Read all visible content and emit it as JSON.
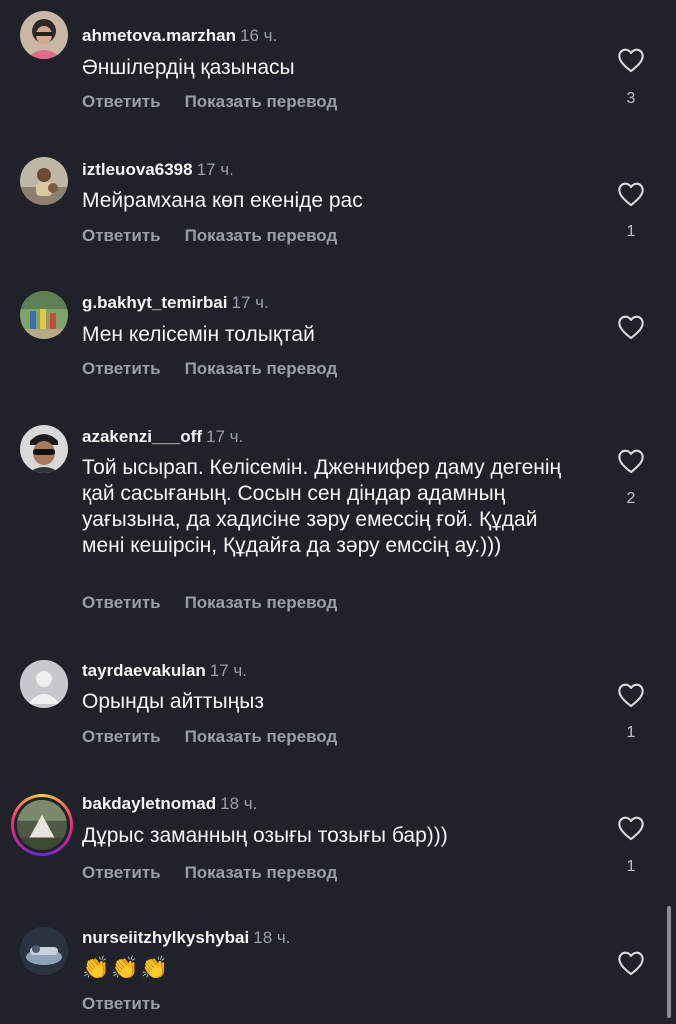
{
  "ui": {
    "reply_label": "Ответить",
    "translate_label": "Показать перевод"
  },
  "comments": [
    {
      "username": "ahmetova.marzhan",
      "time": "16 ч.",
      "text": "Әншілердің қазынасы",
      "likes": "3"
    },
    {
      "username": "iztleuova6398",
      "time": "17 ч.",
      "text": "Мейрамхана көп екеніде рас",
      "likes": "1"
    },
    {
      "username": "g.bakhyt_temirbai",
      "time": "17 ч.",
      "text": "Мен келісемін толықтай",
      "likes": ""
    },
    {
      "username": "azakenzi___off",
      "time": "17 ч.",
      "text": "Той ысырап. Келісемін. Дженнифер даму дегенің қай сасығаның. Сосын сен діндар адамның уағызына, да хадисіне зәру емессің ғой. Құдай мені кешірсін, Құдайға да зәру емссің ау.)))",
      "likes": "2"
    },
    {
      "username": "tayrdaevakulan",
      "time": "17 ч.",
      "text": "Орынды айттыңыз",
      "likes": "1"
    },
    {
      "username": "bakdayletnomad",
      "time": "18 ч.",
      "text": "Дұрыс заманның озығы тозығы бар)))",
      "likes": "1"
    },
    {
      "username": "nurseiitzhylkyshybai",
      "time": "18 ч.",
      "text": "👏👏👏",
      "likes": ""
    }
  ],
  "icons": {
    "like": "heart-outline-icon",
    "default_avatar": "person-placeholder-icon"
  },
  "colors": {
    "background": "#1f2228",
    "primary_text": "#f5f5f5",
    "secondary_text": "#9a9ea6"
  }
}
